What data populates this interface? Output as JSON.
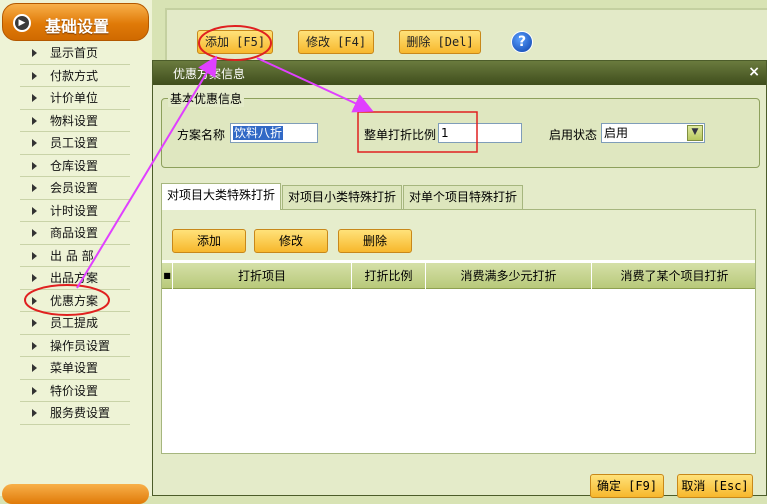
{
  "sidebar": {
    "title": "基础设置",
    "items": [
      "显示首页",
      "付款方式",
      "计价单位",
      "物料设置",
      "员工设置",
      "仓库设置",
      "会员设置",
      "计时设置",
      "商品设置",
      "出 品 部",
      "出品方案",
      "优惠方案",
      "员工提成",
      "操作员设置",
      "菜单设置",
      "特价设置",
      "服务费设置"
    ]
  },
  "toolbar": {
    "add": "添加 [F5]",
    "edit": "修改 [F4]",
    "delete": "删除 [Del]",
    "help": "?"
  },
  "dialog": {
    "title": "优惠方案信息",
    "close": "×",
    "basic_legend": "基本优惠信息",
    "scheme_name_label": "方案名称",
    "scheme_name_value": "饮料八折",
    "ratio_label": "整单打折比例",
    "ratio_value": "1",
    "status_label": "启用状态",
    "status_value": "启用",
    "tabs": [
      "对项目大类特殊打折",
      "对项目小类特殊打折",
      "对单个项目特殊打折"
    ],
    "panel_buttons": {
      "add": "添加",
      "edit": "修改",
      "delete": "删除"
    },
    "grid_columns": [
      "打折项目",
      "打折比例",
      "消费满多少元打折",
      "消费了某个项目打折"
    ],
    "grid_rownum_header": "■",
    "ok": "确定 [F9]",
    "cancel": "取消 [Esc]"
  },
  "colors": {
    "accent_orange": "#f7b72c",
    "annotation": "#e040ff",
    "highlight_red": "#e02020",
    "title_green": "#4c5c2a"
  }
}
